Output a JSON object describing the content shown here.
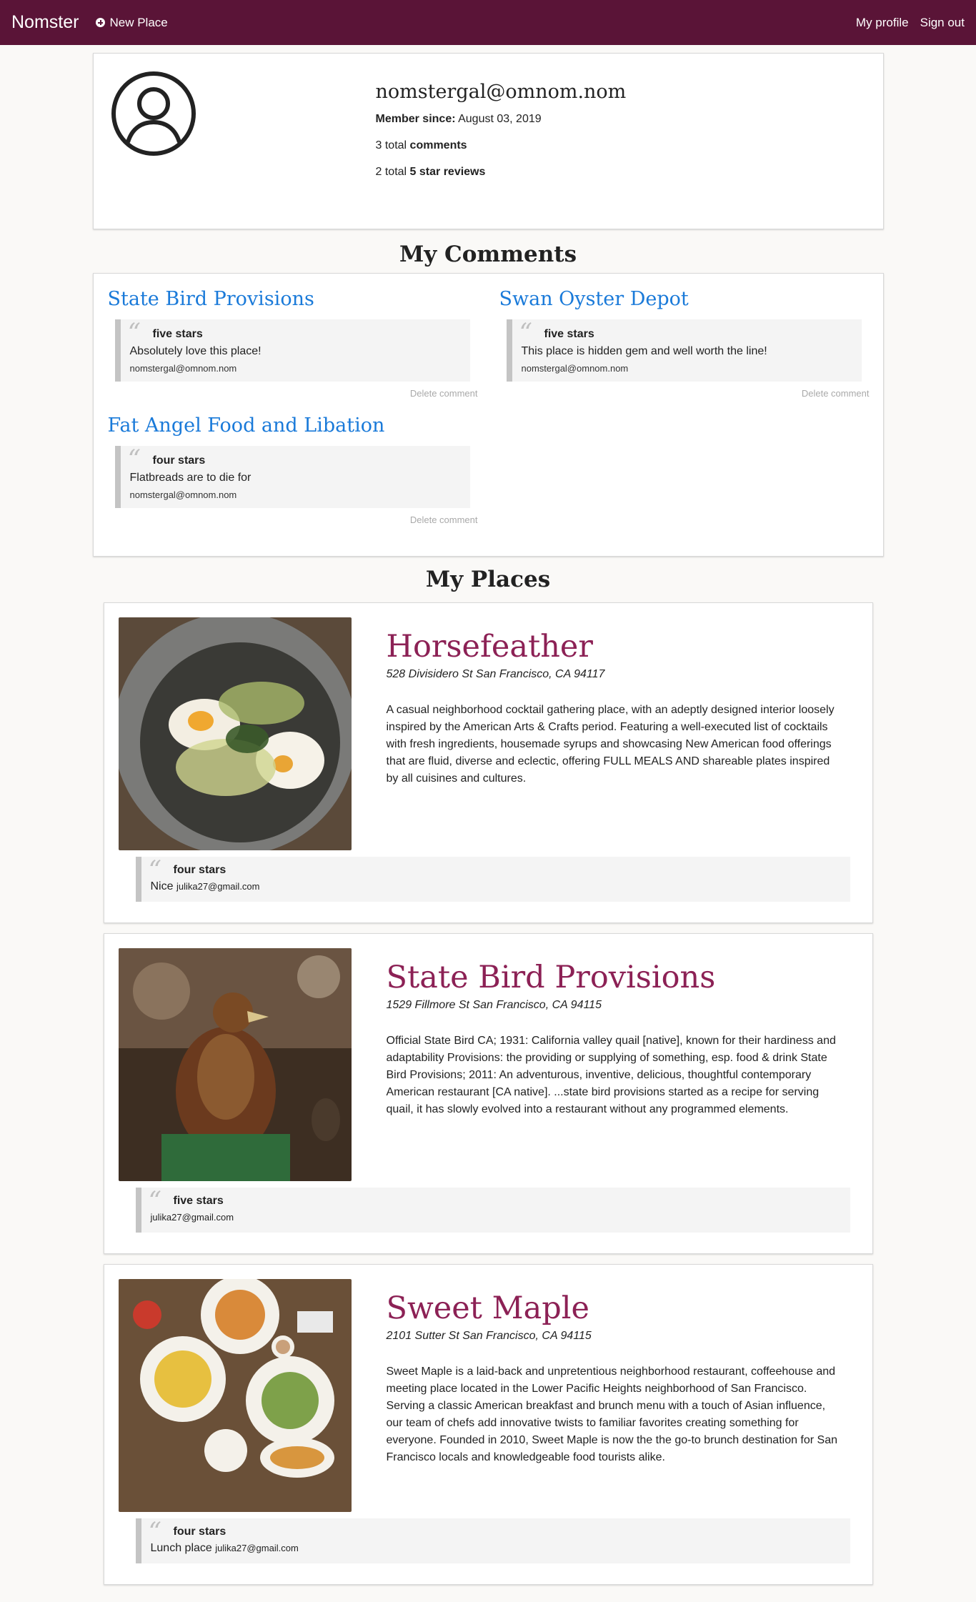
{
  "nav": {
    "brand": "Nomster",
    "new_place": "New Place",
    "my_profile": "My profile",
    "sign_out": "Sign out"
  },
  "profile": {
    "email": "nomstergal@omnom.nom",
    "member_since_label": "Member since:",
    "member_since_value": "August 03, 2019",
    "comments_count": "3 total",
    "comments_word": "comments",
    "reviews_count": "2 total",
    "reviews_word": "5 star reviews"
  },
  "headings": {
    "my_comments": "My Comments",
    "my_places": "My Places"
  },
  "comments": [
    {
      "place": "State Bird Provisions",
      "stars": "five stars",
      "text": "Absolutely love this place!",
      "author": "nomstergal@omnom.nom",
      "delete": "Delete comment"
    },
    {
      "place": "Swan Oyster Depot",
      "stars": "five stars",
      "text": "This place is hidden gem and well worth the line!",
      "author": "nomstergal@omnom.nom",
      "delete": "Delete comment"
    },
    {
      "place": "Fat Angel Food and Libation",
      "stars": "four stars",
      "text": "Flatbreads are to die for",
      "author": "nomstergal@omnom.nom",
      "delete": "Delete comment"
    }
  ],
  "places": [
    {
      "name": "Horsefeather",
      "address": "528 Divisidero St San Francisco, CA 94117",
      "description": "A casual neighborhood cocktail gathering place, with an adeptly designed interior loosely inspired by the American Arts & Crafts period. Featuring a well-executed list of cocktails with fresh ingredients, housemade syrups and showcasing New American food offerings that are fluid, diverse and eclectic, offering FULL MEALS AND shareable plates inspired by all cuisines and cultures.",
      "review_stars": "four stars",
      "review_text": "Nice",
      "review_author": "julika27@gmail.com"
    },
    {
      "name": "State Bird Provisions",
      "address": "1529 Fillmore St San Francisco, CA 94115",
      "description": "Official State Bird CA; 1931: California valley quail [native], known for their hardiness and adaptability Provisions: the providing or supplying of something, esp. food & drink State Bird Provisions; 2011: An adventurous, inventive, delicious, thoughtful contemporary American restaurant [CA native]. ...state bird provisions started as a recipe for serving quail, it has slowly evolved into a restaurant without any programmed elements.",
      "review_stars": "five stars",
      "review_text": "",
      "review_author": "julika27@gmail.com"
    },
    {
      "name": "Sweet Maple",
      "address": "2101 Sutter St San Francisco, CA 94115",
      "description": "Sweet Maple is a laid-back and unpretentious neighborhood restaurant, coffeehouse and meeting place located in the Lower Pacific Heights neighborhood of San Francisco. Serving a classic American breakfast and brunch menu with a touch of Asian influence, our team of chefs add innovative twists to familiar favorites creating something for everyone. Founded in 2010, Sweet Maple is now the the go-to brunch destination for San Francisco locals and knowledgeable food tourists alike.",
      "review_stars": "four stars",
      "review_text": "Lunch place",
      "review_author": "julika27@gmail.com"
    }
  ],
  "colors": {
    "navbar": "#5a1437",
    "place_name": "#8c2155",
    "comment_link": "#1a7ad9"
  }
}
